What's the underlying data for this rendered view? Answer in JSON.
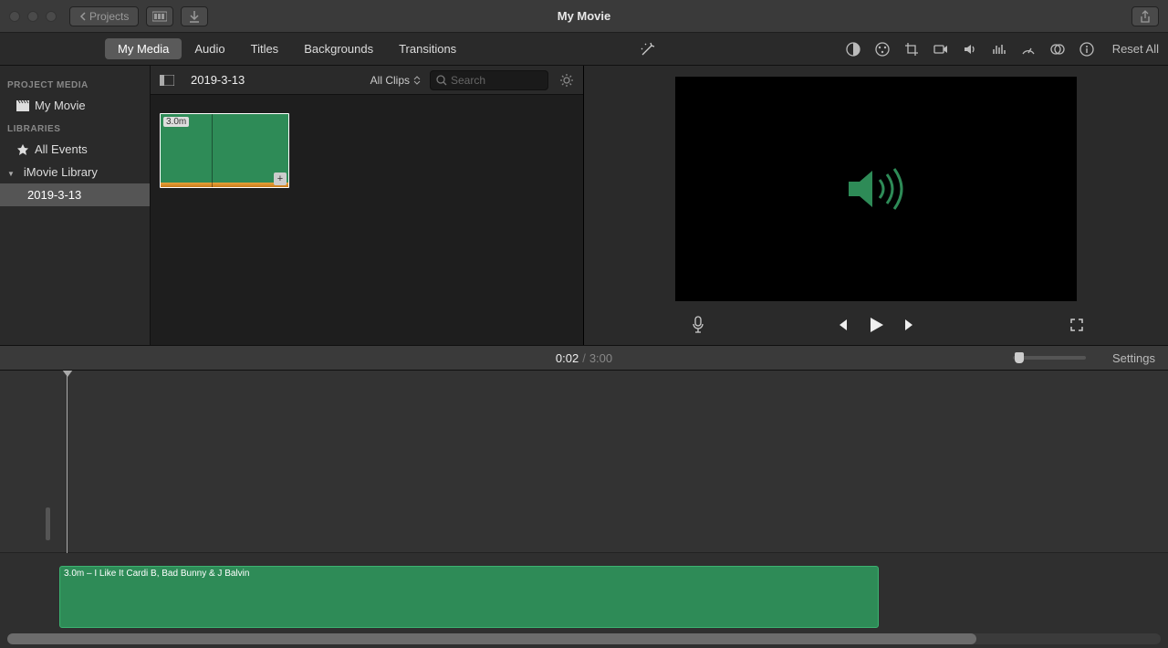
{
  "titlebar": {
    "projects_label": "Projects",
    "title": "My Movie"
  },
  "tabs": {
    "items": [
      "My Media",
      "Audio",
      "Titles",
      "Backgrounds",
      "Transitions"
    ],
    "active_index": 0,
    "reset_label": "Reset All"
  },
  "sidebar": {
    "project_media_head": "PROJECT MEDIA",
    "project_item": "My Movie",
    "libraries_head": "LIBRARIES",
    "all_events": "All Events",
    "library_name": "iMovie Library",
    "event_name": "2019-3-13"
  },
  "browser": {
    "event_title": "2019-3-13",
    "filter_label": "All Clips",
    "search_placeholder": "Search",
    "clip_duration": "3.0m"
  },
  "viewer": {
    "controls": {
      "prev": "prev",
      "play": "play",
      "next": "next"
    }
  },
  "timebar": {
    "current": "0:02",
    "total": "3:00",
    "settings_label": "Settings"
  },
  "timeline": {
    "audio_clip_label": "3.0m – I Like It Cardi B, Bad Bunny & J Balvin"
  }
}
